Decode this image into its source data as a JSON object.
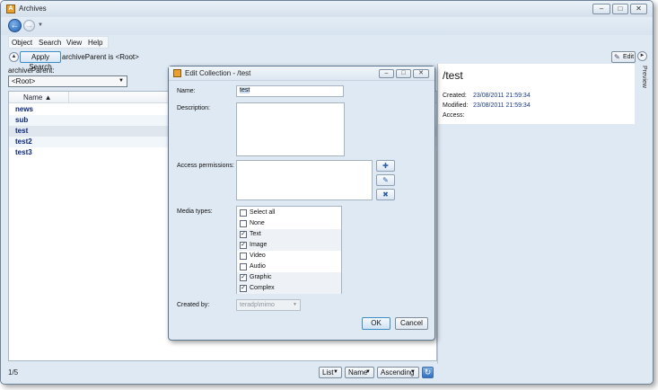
{
  "window": {
    "title": "Archives"
  },
  "menu": {
    "items": [
      "Object",
      "Search",
      "View",
      "Help"
    ]
  },
  "search": {
    "apply_label": "Apply Search",
    "filter_text": "archiveParent is <Root>",
    "param_label": "archiveParent:",
    "param_value": "<Root>"
  },
  "list": {
    "column": "Name",
    "rows": [
      "news",
      "sub",
      "test",
      "test2",
      "test3"
    ],
    "selected": "test"
  },
  "status": {
    "count": "1/5",
    "view_mode": "List",
    "sort_field": "Name",
    "sort_order": "Ascending"
  },
  "preview": {
    "edit_label": "Edit",
    "side_label": "Preview",
    "path": "/test",
    "created_label": "Created:",
    "created_value": "23/08/2011 21:59:34",
    "modified_label": "Modified:",
    "modified_value": "23/08/2011 21:59:34",
    "access_label": "Access:"
  },
  "dialog": {
    "title": "Edit Collection - /test",
    "name_label": "Name:",
    "name_value": "test",
    "description_label": "Description:",
    "permissions_label": "Access permissions:",
    "media_label": "Media types:",
    "media_types": [
      {
        "label": "Select all",
        "checked": false
      },
      {
        "label": "None",
        "checked": false
      },
      {
        "label": "Text",
        "checked": true
      },
      {
        "label": "Image",
        "checked": true
      },
      {
        "label": "Video",
        "checked": false
      },
      {
        "label": "Audio",
        "checked": false
      },
      {
        "label": "Graphic",
        "checked": true
      },
      {
        "label": "Complex",
        "checked": true
      }
    ],
    "created_by_label": "Created by:",
    "created_by_value": "teradp\\mimo",
    "ok_label": "OK",
    "cancel_label": "Cancel"
  }
}
